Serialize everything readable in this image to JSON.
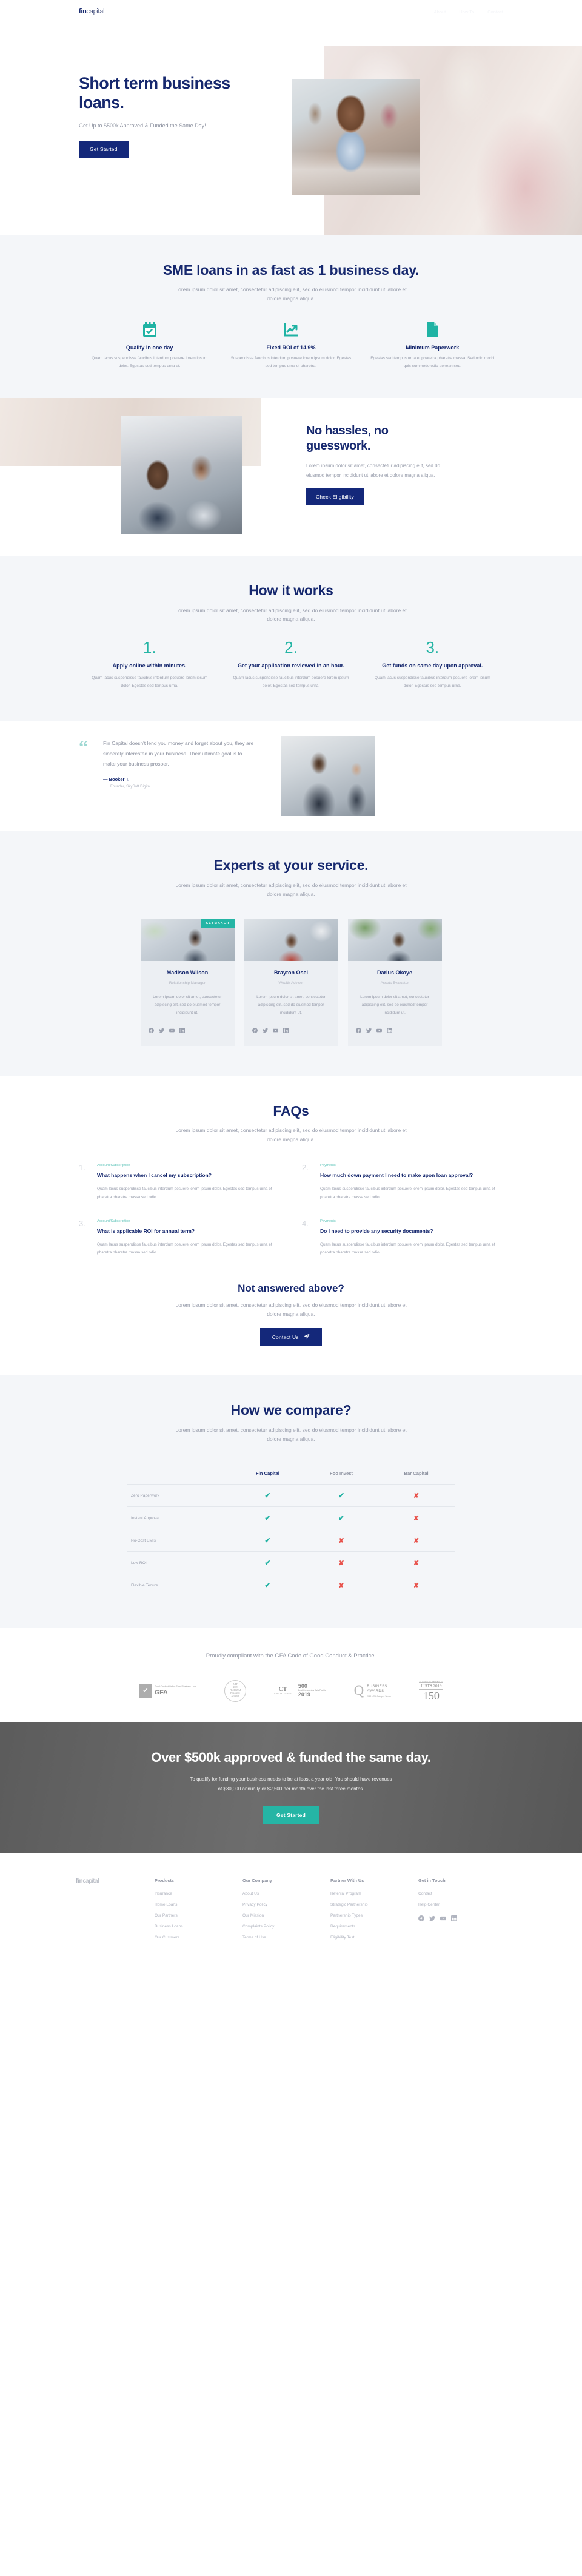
{
  "brand": {
    "name_bold": "fin",
    "name_light": "capital"
  },
  "nav": {
    "items": [
      {
        "label": "About"
      },
      {
        "label": "How To"
      },
      {
        "label": "Contact"
      }
    ]
  },
  "hero": {
    "title": "Short term business loans.",
    "subtitle": "Get Up to $500k Approved & Funded the Same Day!",
    "cta": "Get Started"
  },
  "sme": {
    "title": "SME loans in as fast as 1 business day.",
    "subtitle": "Lorem ipsum dolor sit amet, consectetur adipiscing elit, sed do eiusmod tempor incididunt ut labore et dolore magna aliqua.",
    "features": [
      {
        "icon": "calendar-check-icon",
        "title": "Qualify in one day",
        "body": "Quam lacus suspendisse faucibus interdum posuere lorem ipsum dolor. Egestas sed tempus urna et."
      },
      {
        "icon": "chart-growth-icon",
        "title": "Fixed ROI of 14.9%",
        "body": "Suspendisse faucibus interdum posuere lorem ipsum dolor. Egestas sed tempus urna et pharetra."
      },
      {
        "icon": "document-icon",
        "title": "Minimum Paperwork",
        "body": "Egestas sed tempus urna et pharetra pharetra massa. Sed odio morbi quis commodo odio aenean sed."
      }
    ]
  },
  "hassles": {
    "title": "No hassles, no guesswork.",
    "body": "Lorem ipsum dolor sit amet, consectetur adipiscing elit, sed do eiusmod tempor incididunt ut labore et dolore magna aliqua.",
    "cta": "Check Eligibility"
  },
  "how": {
    "title": "How it works",
    "subtitle": "Lorem ipsum dolor sit amet, consectetur adipiscing elit, sed do eiusmod tempor incididunt ut labore et dolore magna aliqua.",
    "steps": [
      {
        "num": "1.",
        "title": "Apply online within minutes.",
        "body": "Quam lacus suspendisse faucibus interdum posuere lorem ipsum dolor. Egestas sed tempus urna."
      },
      {
        "num": "2.",
        "title": "Get your application reviewed in an hour.",
        "body": "Quam lacus suspendisse faucibus interdum posuere lorem ipsum dolor. Egestas sed tempus urna."
      },
      {
        "num": "3.",
        "title": "Get funds on same day upon approval.",
        "body": "Quam lacus suspendisse faucibus interdum posuere lorem ipsum dolor. Egestas sed tempus urna."
      }
    ]
  },
  "testimonial": {
    "quote": "Fin Capital doesn't lend you money and forget about you, they are sincerely interested in your business. Their ultimate goal is to make your business prosper.",
    "author": "— Booker T.",
    "role": "Founder, SkySoft Digital"
  },
  "experts": {
    "title": "Experts at your service.",
    "subtitle": "Lorem ipsum dolor sit amet, consectetur adipiscing elit, sed do eiusmod tempor incididunt ut labore et dolore magna aliqua.",
    "members": [
      {
        "badge": "KEYMAKER",
        "name": "Madison Wilson",
        "role": "Relationship Manager",
        "body": "Lorem ipsum dolor sit amet, consectetur adipiscing elit, sed do eiusmod tempor incididunt ut."
      },
      {
        "badge": "",
        "name": "Brayton Osei",
        "role": "Wealth Adviser",
        "body": "Lorem ipsum dolor sit amet, consectetur adipiscing elit, sed do eiusmod tempor incididunt ut."
      },
      {
        "badge": "",
        "name": "Darius Okoye",
        "role": "Assets Evaluator",
        "body": "Lorem ipsum dolor sit amet, consectetur adipiscing elit, sed do eiusmod tempor incididunt ut."
      }
    ]
  },
  "faq": {
    "title": "FAQs",
    "subtitle": "Lorem ipsum dolor sit amet, consectetur adipiscing elit, sed do eiusmod tempor incididunt ut labore et dolore magna aliqua.",
    "items": [
      {
        "num": "1.",
        "category": "Account/Subscription",
        "question": "What happens when I cancel my subscription?",
        "answer": "Quam lacus suspendisse faucibus interdum posuere lorem ipsum dolor. Egestas sed tempus urna et pharetra pharetra massa sed odio."
      },
      {
        "num": "2.",
        "category": "Payments",
        "question": "How much down payment I need to make upon loan approval?",
        "answer": "Quam lacus suspendisse faucibus interdum posuere lorem ipsum dolor. Egestas sed tempus urna et pharetra pharetra massa sed odio."
      },
      {
        "num": "3.",
        "category": "Account/Subscription",
        "question": "What is applicable ROI for annual term?",
        "answer": "Quam lacus suspendisse faucibus interdum posuere lorem ipsum dolor. Egestas sed tempus urna et pharetra pharetra massa sed odio."
      },
      {
        "num": "4.",
        "category": "Payments",
        "question": "Do I need to provide any security documents?",
        "answer": "Quam lacus suspendisse faucibus interdum posuere lorem ipsum dolor. Egestas sed tempus urna et pharetra pharetra massa sed odio."
      }
    ],
    "not_answered_title": "Not answered above?",
    "not_answered_sub": "Lorem ipsum dolor sit amet, consectetur adipiscing elit, sed do eiusmod tempor incididunt ut labore et dolore magna aliqua.",
    "contact_cta": "Contact Us"
  },
  "compare": {
    "title": "How we compare?",
    "subtitle": "Lorem ipsum dolor sit amet, consectetur adipiscing elit, sed do eiusmod tempor incididunt ut labore et dolore magna aliqua.",
    "columns": [
      "",
      "Fin Capital",
      "Foo Invest",
      "Bar Capital"
    ],
    "rows": [
      {
        "feature": "Zero Paperwork",
        "values": [
          true,
          true,
          false
        ]
      },
      {
        "feature": "Instant Approval",
        "values": [
          true,
          true,
          false
        ]
      },
      {
        "feature": "No-Cost EMIs",
        "values": [
          true,
          false,
          false
        ]
      },
      {
        "feature": "Low ROI",
        "values": [
          true,
          false,
          false
        ]
      },
      {
        "feature": "Flexible Tenure",
        "values": [
          true,
          false,
          false
        ]
      }
    ],
    "tick_glyph": "✔",
    "cross_glyph": "✘",
    "tick_color": "#23b3a4",
    "cross_color": "#e8524b"
  },
  "compliance": {
    "text": "Proudly compliant with the GFA Code of Good Conduct & Practice.",
    "logos": [
      {
        "name": "gfa-logo",
        "top_lines": "Good Conduct Online Small Business Loan",
        "label": "GFA"
      },
      {
        "name": "aiff-award-logo",
        "lines": [
          "AIFF",
          "2019",
          "PLATINUM",
          "FINANCE",
          "AWARD"
        ]
      },
      {
        "name": "capital-times-500-logo",
        "left_top": "CT",
        "left_bottom": "CAPITAL TIMES",
        "right_num": "500",
        "right_sub": "Best Companies Asia Pacific",
        "right_year": "2019"
      },
      {
        "name": "business-awards-logo",
        "line1": "BUSINESS",
        "line2": "AWARDS",
        "line3": "2019 NSW Category Winner"
      },
      {
        "name": "capital-review-lists-150-logo",
        "cap": "— CAPITAL REVIEW —",
        "lists": "LISTS 2019",
        "num": "150"
      }
    ]
  },
  "cta": {
    "title": "Over $500k approved & funded the same day.",
    "body": "To qualify for funding your business needs to be at least a year old. You should have revenues of $30,000 annually or $2,500 per month over the last three months.",
    "button": "Get Started"
  },
  "footer": {
    "columns": [
      {
        "heading": "Products",
        "links": [
          "Insurance",
          "Home Loans",
          "Our Partners",
          "Business Loans",
          "Our Custmers"
        ]
      },
      {
        "heading": "Our Company",
        "links": [
          "About Us",
          "Privacy Policy",
          "Our Mission",
          "Complaints Policy",
          "Terms of Use"
        ]
      },
      {
        "heading": "Partner With Us",
        "links": [
          "Referral Program",
          "Strategic Partnership",
          "Partnership Types",
          "Requirements",
          "Eligibility Test"
        ]
      },
      {
        "heading": "Get in Touch",
        "links": [
          "Contact",
          "Help Center"
        ]
      }
    ],
    "socials": [
      "facebook-icon",
      "twitter-icon",
      "youtube-icon",
      "linkedin-icon"
    ]
  },
  "colors": {
    "navy": "#16286e",
    "button_navy": "#14287a",
    "teal": "#25b5a5",
    "muted": "#9a9fad",
    "panel": "#f4f6f9"
  }
}
